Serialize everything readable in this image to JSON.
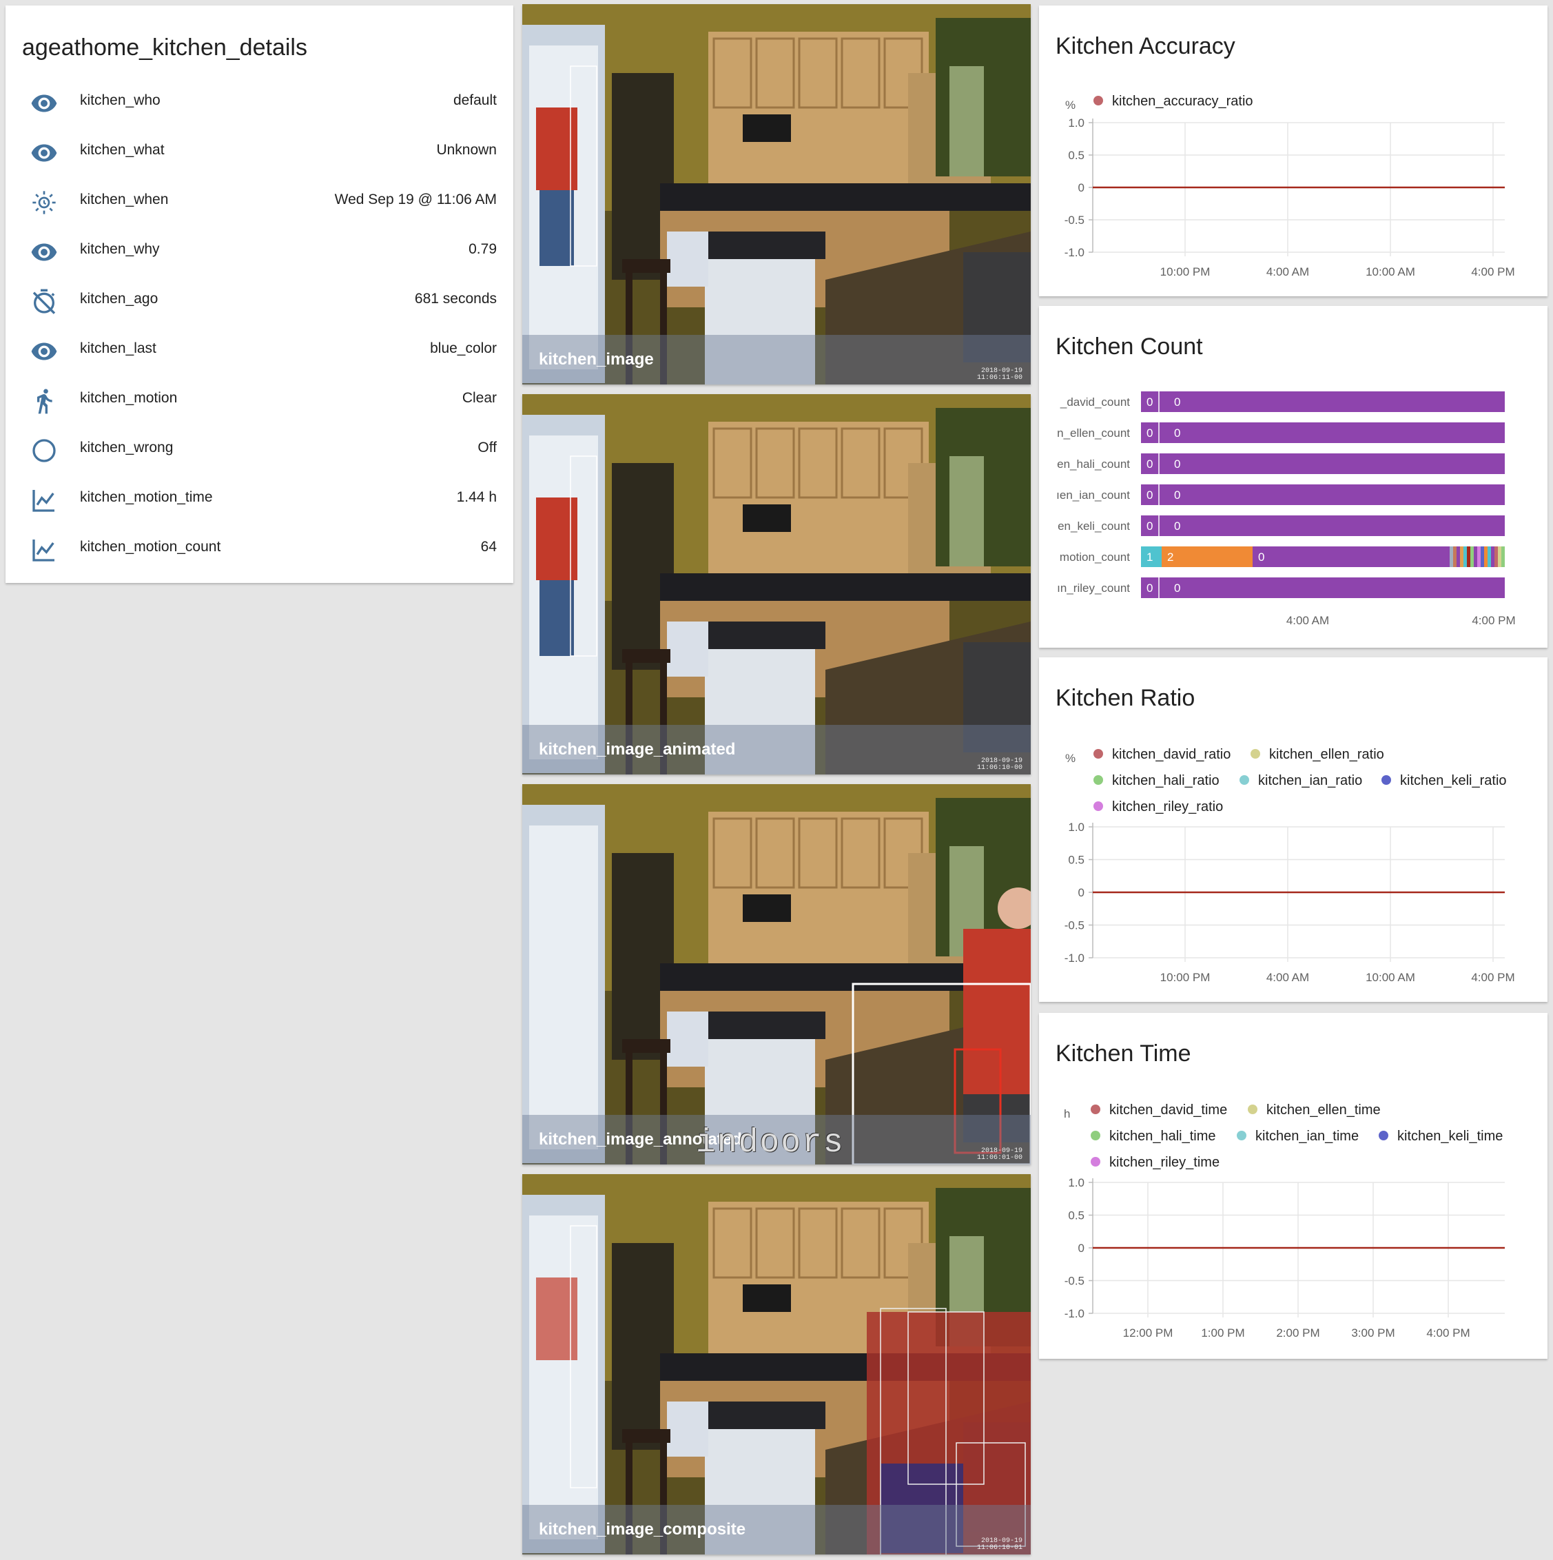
{
  "entities": {
    "title": "ageathome_kitchen_details",
    "rows": [
      {
        "icon": "eye-icon",
        "name": "kitchen_who",
        "value": "default"
      },
      {
        "icon": "eye-icon",
        "name": "kitchen_what",
        "value": "Unknown"
      },
      {
        "icon": "sun-clock-icon",
        "name": "kitchen_when",
        "value": "Wed Sep 19 @ 11:06 AM"
      },
      {
        "icon": "eye-icon",
        "name": "kitchen_why",
        "value": "0.79"
      },
      {
        "icon": "timer-off-icon",
        "name": "kitchen_ago",
        "value": "681 seconds"
      },
      {
        "icon": "eye-icon",
        "name": "kitchen_last",
        "value": "blue_color"
      },
      {
        "icon": "walk-icon",
        "name": "kitchen_motion",
        "value": "Clear"
      },
      {
        "icon": "circle-outline-icon",
        "name": "kitchen_wrong",
        "value": "Off"
      },
      {
        "icon": "chart-line-icon",
        "name": "kitchen_motion_time",
        "value": "1.44 h"
      },
      {
        "icon": "chart-line-icon",
        "name": "kitchen_motion_count",
        "value": "64"
      }
    ]
  },
  "cameras": [
    {
      "label": "kitchen_image",
      "timestamp": "2018-09-19\n11:06:11-00"
    },
    {
      "label": "kitchen_image_animated",
      "timestamp": "2018-09-19\n11:06:10-00"
    },
    {
      "label": "kitchen_image_annotated",
      "timestamp": "2018-09-19\n11:06:01-00",
      "overlay_text": "indoors"
    },
    {
      "label": "kitchen_image_composite",
      "timestamp": "2018-09-19\n11:06:10-01"
    }
  ],
  "colors": {
    "icon": "#44739e",
    "line_red": "#a5281b",
    "count_purple": "#8e44ad",
    "count_teal": "#4fc3cf",
    "count_orange": "#f08a35"
  },
  "chart_data": [
    {
      "title": "Kitchen Accuracy",
      "type": "line",
      "unit": "%",
      "legend": [
        {
          "name": "kitchen_accuracy_ratio",
          "color": "#c0676b"
        }
      ],
      "ylim": [
        -1.0,
        1.0
      ],
      "yticks": [
        "1.0",
        "0.5",
        "0",
        "-0.5",
        "-1.0"
      ],
      "xticks": [
        "10:00 PM",
        "4:00 AM",
        "10:00 AM",
        "4:00 PM"
      ],
      "series": [
        {
          "name": "kitchen_accuracy_ratio",
          "values": [
            0,
            0
          ]
        }
      ]
    },
    {
      "title": "Kitchen Count",
      "type": "timeline",
      "rows": [
        {
          "label": "_david_count",
          "segments": [
            "0",
            "0"
          ]
        },
        {
          "label": "n_ellen_count",
          "segments": [
            "0",
            "0"
          ]
        },
        {
          "label": "en_hali_count",
          "segments": [
            "0",
            "0"
          ]
        },
        {
          "label": "ıen_ian_count",
          "segments": [
            "0",
            "0"
          ]
        },
        {
          "label": "en_keli_count",
          "segments": [
            "0",
            "0"
          ]
        },
        {
          "label": "motion_count",
          "segments": [
            "1",
            "2",
            "0"
          ]
        },
        {
          "label": "ın_riley_count",
          "segments": [
            "0",
            "0"
          ]
        }
      ],
      "xticks": [
        "4:00 AM",
        "4:00 PM"
      ]
    },
    {
      "title": "Kitchen Ratio",
      "type": "line",
      "unit": "%",
      "legend": [
        {
          "name": "kitchen_david_ratio",
          "color": "#c0676b"
        },
        {
          "name": "kitchen_ellen_ratio",
          "color": "#d4d28e"
        },
        {
          "name": "kitchen_hali_ratio",
          "color": "#8fce7e"
        },
        {
          "name": "kitchen_ian_ratio",
          "color": "#87cfd3"
        },
        {
          "name": "kitchen_keli_ratio",
          "color": "#5c63c9"
        },
        {
          "name": "kitchen_riley_ratio",
          "color": "#d47ede"
        }
      ],
      "ylim": [
        -1.0,
        1.0
      ],
      "yticks": [
        "1.0",
        "0.5",
        "0",
        "-0.5",
        "-1.0"
      ],
      "xticks": [
        "10:00 PM",
        "4:00 AM",
        "10:00 AM",
        "4:00 PM"
      ],
      "series": [
        {
          "name": "kitchen_david_ratio",
          "values": [
            0,
            0
          ]
        }
      ]
    },
    {
      "title": "Kitchen Time",
      "type": "line",
      "unit": "h",
      "legend": [
        {
          "name": "kitchen_david_time",
          "color": "#c0676b"
        },
        {
          "name": "kitchen_ellen_time",
          "color": "#d4d28e"
        },
        {
          "name": "kitchen_hali_time",
          "color": "#8fce7e"
        },
        {
          "name": "kitchen_ian_time",
          "color": "#87cfd3"
        },
        {
          "name": "kitchen_keli_time",
          "color": "#5c63c9"
        },
        {
          "name": "kitchen_riley_time",
          "color": "#d47ede"
        }
      ],
      "ylim": [
        -1.0,
        1.0
      ],
      "yticks": [
        "1.0",
        "0.5",
        "0",
        "-0.5",
        "-1.0"
      ],
      "xticks": [
        "12:00 PM",
        "1:00 PM",
        "2:00 PM",
        "3:00 PM",
        "4:00 PM"
      ],
      "series": [
        {
          "name": "kitchen_david_time",
          "values": [
            0,
            0
          ]
        }
      ]
    }
  ]
}
